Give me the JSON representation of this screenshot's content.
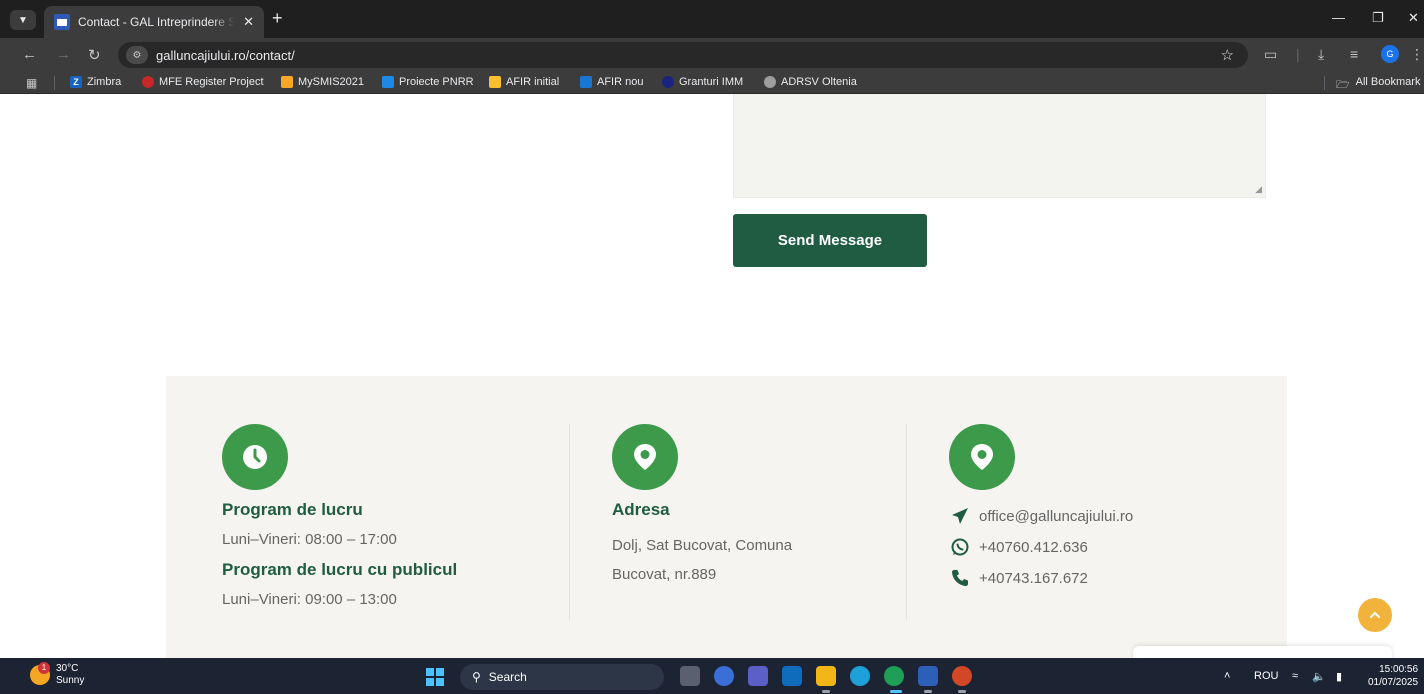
{
  "browser": {
    "tab_title": "Contact - GAL Intreprindere So",
    "url": "galluncajiului.ro/contact/",
    "profile_initial": "G",
    "bookmarks": [
      {
        "label": "Zimbra",
        "icon": "zimbra-icon",
        "color": "#1565c0"
      },
      {
        "label": "MFE Register Project",
        "icon": "mfe-icon",
        "color": "#c62828"
      },
      {
        "label": "MySMIS2021",
        "icon": "mysmis-icon",
        "color": "#f9a825"
      },
      {
        "label": "Proiecte PNRR",
        "icon": "pnrr-icon",
        "color": "#1e88e5"
      },
      {
        "label": "AFIR initial",
        "icon": "afir-initial-icon",
        "color": "#fbc02d"
      },
      {
        "label": "AFIR nou",
        "icon": "afir-nou-icon",
        "color": "#1976d2"
      },
      {
        "label": "Granturi IMM",
        "icon": "granturi-icon",
        "color": "#1a237e"
      },
      {
        "label": "ADRSV Oltenia",
        "icon": "globe-icon",
        "color": "#9e9e9e"
      }
    ],
    "all_bookmarks": "All Bookmark"
  },
  "form": {
    "send_button": "Send Message"
  },
  "info": {
    "schedule_title": "Program de lucru",
    "schedule_hours": "Luni–Vineri: 08:00 – 17:00",
    "public_title": "Program de lucru cu publicul",
    "public_hours": "Luni–Vineri: 09:00 – 13:00",
    "address_title": "Adresa",
    "address_line1": "Dolj, Sat Bucovat, Comuna",
    "address_line2": "Bucovat, nr.889",
    "email": "office@galluncajiului.ro",
    "whatsapp": "+40760.412.636",
    "phone": "+40743.167.672"
  },
  "colors": {
    "brand_green": "#1f5c42",
    "icon_green": "#3d9a4a",
    "scroll_top": "#f2b33d"
  },
  "taskbar": {
    "temperature": "30°C",
    "weather": "Sunny",
    "weather_badge": "1",
    "search": "Search",
    "language": "ROU",
    "time": "15:00:56",
    "date": "01/07/2025"
  }
}
